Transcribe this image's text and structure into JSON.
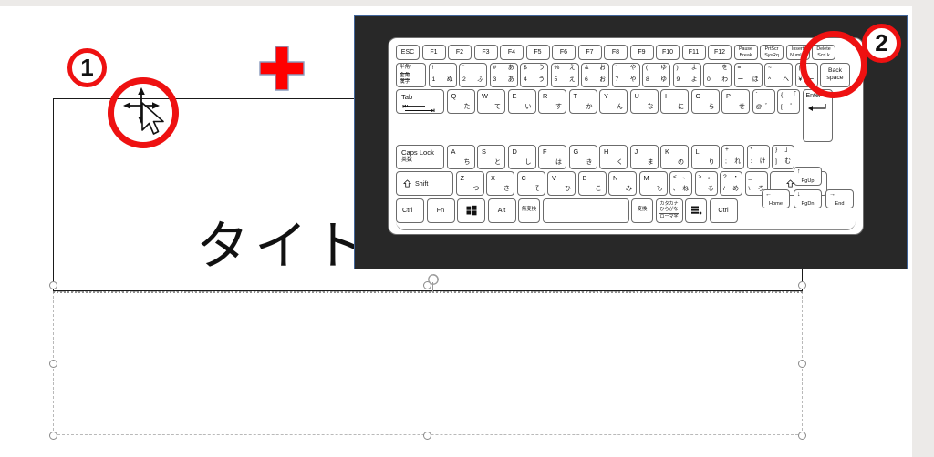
{
  "app": {
    "name": "presentation-editor",
    "canvas_background": "#ffffff",
    "chrome_color": "#eceae8"
  },
  "slide": {
    "title_placeholder": {
      "text": "タイトルを入力",
      "state": "selected",
      "border_color": "#1a1a1a"
    },
    "subtitle_placeholder": {
      "text": "",
      "state": "selected",
      "border_style": "dashed",
      "border_color": "#b9b9b9",
      "handle_count": 8
    },
    "picture": {
      "name": "keyboard-screenshot",
      "background": "#282828",
      "border_color": "#41659a",
      "state": "selected"
    }
  },
  "annotations": {
    "badges": [
      {
        "label": "1",
        "color": "#ee1111"
      },
      {
        "label": "2",
        "color": "#ee1111"
      }
    ],
    "rings": [
      {
        "name": "cursor-highlight-ring",
        "color": "#ee1111"
      },
      {
        "name": "backspace-highlight-ring",
        "color": "#ee1111"
      }
    ],
    "cross": {
      "name": "red-cross-marker",
      "fill": "#ff0000",
      "stroke": "#8a9bbd"
    },
    "cursor": {
      "name": "move-cursor",
      "type": "four-way-move-with-pointer"
    }
  },
  "keyboard": {
    "layout": "JIS",
    "function_row": [
      {
        "label": "ESC"
      },
      {
        "label": "F1"
      },
      {
        "label": "F2"
      },
      {
        "label": "F3"
      },
      {
        "label": "F4"
      },
      {
        "label": "F5"
      },
      {
        "label": "F6"
      },
      {
        "label": "F7"
      },
      {
        "label": "F8"
      },
      {
        "label": "F9"
      },
      {
        "label": "F10"
      },
      {
        "label": "F11"
      },
      {
        "label": "F12"
      },
      {
        "top": "Pause",
        "bottom": "Break"
      },
      {
        "top": "PrtScr",
        "bottom": "SysRq"
      },
      {
        "top": "Insert",
        "bottom": "NumLk"
      },
      {
        "top": "Delete",
        "bottom": "ScrLk"
      }
    ],
    "number_row": {
      "hankaku": {
        "l1": "半角/",
        "l2": "全角",
        "l3": "漢字"
      },
      "keys": [
        {
          "tl": "!",
          "tr": "",
          "bl": "1",
          "br": "ぬ"
        },
        {
          "tl": "\"",
          "tr": "",
          "bl": "2",
          "br": "ふ"
        },
        {
          "tl": "#",
          "tr": "あ",
          "bl": "3",
          "br": "あ"
        },
        {
          "tl": "$",
          "tr": "う",
          "bl": "4",
          "br": "う"
        },
        {
          "tl": "%",
          "tr": "え",
          "bl": "5",
          "br": "え"
        },
        {
          "tl": "&",
          "tr": "お",
          "bl": "6",
          "br": "お"
        },
        {
          "tl": "'",
          "tr": "や",
          "bl": "7",
          "br": "や"
        },
        {
          "tl": "(",
          "tr": "ゆ",
          "bl": "8",
          "br": "ゆ"
        },
        {
          "tl": ")",
          "tr": "よ",
          "bl": "9",
          "br": "よ"
        },
        {
          "tl": "",
          "tr": "を",
          "bl": "0",
          "br": "わ"
        },
        {
          "tl": "=",
          "tr": "",
          "bl": "ー",
          "br": "ほ"
        },
        {
          "tl": "~",
          "tr": "",
          "bl": "^",
          "br": "へ"
        },
        {
          "tl": "|",
          "tr": "",
          "bl": "¥",
          "br": "ー"
        }
      ],
      "backspace": {
        "l1": "Back",
        "l2": "space"
      }
    },
    "tab_row": {
      "tab": "Tab",
      "keys": [
        {
          "tl": "Q",
          "br": "た"
        },
        {
          "tl": "W",
          "br": "て"
        },
        {
          "tl": "E",
          "br": "い"
        },
        {
          "tl": "R",
          "br": "す"
        },
        {
          "tl": "T",
          "br": "か"
        },
        {
          "tl": "Y",
          "br": "ん"
        },
        {
          "tl": "U",
          "br": "な"
        },
        {
          "tl": "I",
          "br": "に"
        },
        {
          "tl": "O",
          "br": "ら"
        },
        {
          "tl": "P",
          "br": "せ"
        },
        {
          "tl": "`",
          "br": "@",
          "br2": "゛"
        },
        {
          "tl": "{",
          "tr": "「",
          "bl": "[",
          "br": "゜"
        }
      ],
      "enter": "Enter"
    },
    "caps_row": {
      "caps": {
        "l1": "Caps Lock",
        "l2": "英数"
      },
      "keys": [
        {
          "tl": "A",
          "br": "ち"
        },
        {
          "tl": "S",
          "br": "と"
        },
        {
          "tl": "D",
          "br": "し"
        },
        {
          "tl": "F",
          "br": "は"
        },
        {
          "tl": "G",
          "br": "き"
        },
        {
          "tl": "H",
          "br": "く"
        },
        {
          "tl": "J",
          "br": "ま"
        },
        {
          "tl": "K",
          "br": "の"
        },
        {
          "tl": "L",
          "br": "り"
        },
        {
          "tl": "+",
          "bl": ";",
          "br": "れ"
        },
        {
          "tl": "*",
          "bl": ":",
          "br": "け"
        },
        {
          "tl": "}",
          "tr": "」",
          "bl": "]",
          "br": "む"
        }
      ]
    },
    "shift_row": {
      "shift_left": "Shift",
      "shift_right": "Shift",
      "keys": [
        {
          "tl": "Z",
          "br": "つ"
        },
        {
          "tl": "X",
          "br": "さ"
        },
        {
          "tl": "C",
          "br": "そ"
        },
        {
          "tl": "V",
          "br": "ひ"
        },
        {
          "tl": "B",
          "br": "こ"
        },
        {
          "tl": "N",
          "br": "み"
        },
        {
          "tl": "M",
          "br": "も"
        },
        {
          "tl": "<",
          "tr": "、",
          "bl": "､",
          "br": "ね"
        },
        {
          "tl": ">",
          "tr": "。",
          "bl": "･",
          "br": "る"
        },
        {
          "tl": "?",
          "tr": "・",
          "bl": "/",
          "br": "め"
        },
        {
          "tl": "_",
          "bl": "\\",
          "br": "ろ"
        }
      ]
    },
    "bottom_row": {
      "ctrl_left": "Ctrl",
      "fn": "Fn",
      "win": "win-icon",
      "alt": "Alt",
      "muhenkan": "無変換",
      "space": "",
      "henkan": "変換",
      "katakana": {
        "l1": "カタカナ",
        "l2": "ひらがな",
        "l3": "ローマ字"
      },
      "ime_toggle": "ime-icon",
      "ctrl_right": "Ctrl"
    },
    "nav_cluster": [
      {
        "label": "PgUp",
        "glyph": "↑"
      },
      {
        "label": "Home",
        "glyph": "←"
      },
      {
        "label": "PgDn",
        "glyph": "↓"
      },
      {
        "label": "End",
        "glyph": "→"
      }
    ]
  }
}
